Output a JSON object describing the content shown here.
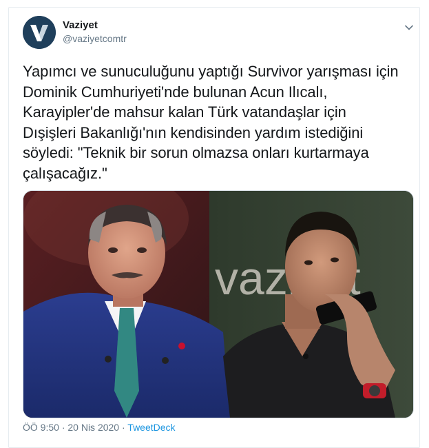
{
  "tweet": {
    "author": {
      "display_name": "Vaziyet",
      "handle": "@vaziyetcomtr",
      "avatar_letter": "V"
    },
    "text_lines": [
      "Yapımcı ve sunuculuğunu yaptığı Survivor yarışması için",
      "Dominik Cumhuriyeti'nde bulunan Acun Ilıcalı,",
      "Karayipler'de mahsur kalan Türk vatandaşlar için",
      "Dışişleri Bakanlığı'nın kendisinden yardım istediğini",
      "söyledi: \"Teknik bir sorun olmazsa onları kurtarmaya",
      "çalışacağız.\""
    ],
    "media": {
      "backdrop_text": "vaziyet"
    },
    "meta": {
      "time": "ÖÖ 9:50",
      "separator": "·",
      "date": "20 Nis 2020",
      "source": "TweetDeck"
    },
    "colors": {
      "link": "#1b95e0",
      "meta": "#657786",
      "avatar_bg": "#1f3f5b"
    }
  }
}
